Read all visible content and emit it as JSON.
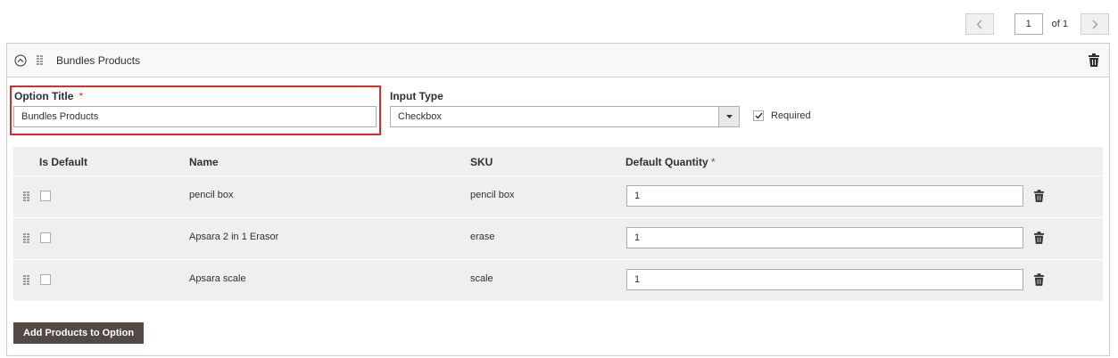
{
  "pager": {
    "current_page": "1",
    "of_label": "of 1"
  },
  "option": {
    "header_title": "Bundles Products",
    "option_title_label": "Option Title",
    "required_star": "*",
    "option_title_value": "Bundles Products",
    "input_type_label": "Input Type",
    "input_type_value": "Checkbox",
    "required_label": "Required",
    "required_checked": true
  },
  "table": {
    "headers": {
      "is_default": "Is Default",
      "name": "Name",
      "sku": "SKU",
      "default_quantity": "Default Quantity",
      "required_star": "*"
    },
    "rows": [
      {
        "name": "pencil box",
        "sku": "pencil box",
        "qty": "1"
      },
      {
        "name": "Apsara 2 in 1 Erasor",
        "sku": "erase",
        "qty": "1"
      },
      {
        "name": "Apsara scale",
        "sku": "scale",
        "qty": "1"
      }
    ]
  },
  "actions": {
    "add_products_label": "Add Products to Option"
  },
  "colors": {
    "highlight": "#e02b27",
    "button_bg": "#514943",
    "star": "#e22626"
  }
}
